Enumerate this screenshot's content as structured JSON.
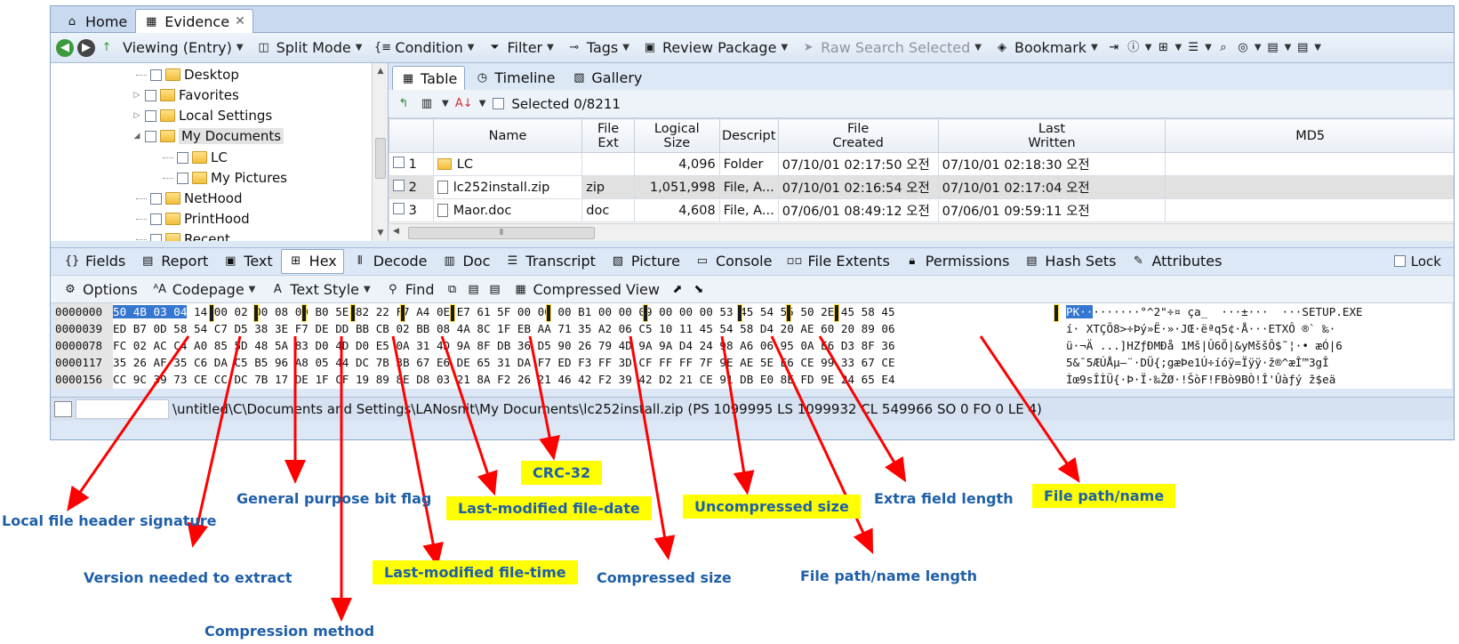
{
  "tabs": [
    {
      "label": "Home"
    },
    {
      "label": "Evidence"
    }
  ],
  "toolbar1": {
    "viewing": "Viewing (Entry)",
    "split": "Split Mode",
    "condition": "Condition",
    "filter": "Filter",
    "tags": "Tags",
    "review": "Review Package",
    "raw_search": "Raw Search Selected",
    "bookmark": "Bookmark"
  },
  "tree": {
    "items": [
      {
        "label": "Desktop"
      },
      {
        "label": "Favorites"
      },
      {
        "label": "Local Settings"
      },
      {
        "label": "My Documents"
      },
      {
        "label": "LC"
      },
      {
        "label": "My Pictures"
      },
      {
        "label": "NetHood"
      },
      {
        "label": "PrintHood"
      },
      {
        "label": "Recent"
      }
    ]
  },
  "view_tabs": [
    {
      "label": "Table"
    },
    {
      "label": "Timeline"
    },
    {
      "label": "Gallery"
    }
  ],
  "table_toolbar": {
    "selected": "Selected 0/8211"
  },
  "table": {
    "headers": {
      "name": "Name",
      "ext": "File\nExt",
      "size": "Logical\nSize",
      "desc": "Descript",
      "created": "File\nCreated",
      "written": "Last\nWritten",
      "md5": "MD5"
    },
    "rows": [
      {
        "idx": "1",
        "name": "LC",
        "ext": "",
        "size": "4,096",
        "desc": "Folder",
        "created": "07/10/01 02:17:50 오전",
        "written": "07/10/01 02:18:30 오전"
      },
      {
        "idx": "2",
        "name": "lc252install.zip",
        "ext": "zip",
        "size": "1,051,998",
        "desc": "File, A...",
        "created": "07/10/01 02:16:54 오전",
        "written": "07/10/01 02:17:04 오전"
      },
      {
        "idx": "3",
        "name": "Maor.doc",
        "ext": "doc",
        "size": "4,608",
        "desc": "File, A...",
        "created": "07/06/01 08:49:12 오전",
        "written": "07/06/01 09:59:11 오전"
      }
    ]
  },
  "bottom_tabs": [
    {
      "label": "Fields"
    },
    {
      "label": "Report"
    },
    {
      "label": "Text"
    },
    {
      "label": "Hex"
    },
    {
      "label": "Decode"
    },
    {
      "label": "Doc"
    },
    {
      "label": "Transcript"
    },
    {
      "label": "Picture"
    },
    {
      "label": "Console"
    },
    {
      "label": "File Extents"
    },
    {
      "label": "Permissions"
    },
    {
      "label": "Hash Sets"
    },
    {
      "label": "Attributes"
    }
  ],
  "lock": "Lock",
  "hex_toolbar": {
    "options": "Options",
    "codepage": "Codepage",
    "text_style": "Text Style",
    "find": "Find",
    "compressed": "Compressed View"
  },
  "hex": {
    "lines": [
      {
        "off": "0000000",
        "sel": "50 4B 03 04",
        "rest": " 14 00 02 00 08 00 B0 5E 82 22 F7 A4 0E E7 61 5F 00 00 00 B1 00 00 09 00 00 00 53 45 54 55 50 2E 45 58 45",
        "asc_sel": "PK··",
        "asc_rest": "·······°^2\"÷¤ ça_  ···±···  ···SETUP.EXE"
      },
      {
        "off": "0000039",
        "sel": "",
        "rest": "ED B7 0D 58 54 C7 D5 38 3E F7 DE DD BB CB 02 BB 08 4A 8C 1F EB AA 71 35 A2 06 C5 10 11 45 54 58 D4 20 AE 60 20 89 06",
        "asc_sel": "",
        "asc_rest": "í· XTÇÕ8>÷Þý»Ë·»·JŒ·ëªq5¢·Å···ETXÔ ®` ‰·"
      },
      {
        "off": "0000078",
        "sel": "",
        "rest": "FC 02 AC C4 A0 85 5D 48 5A 83 D0 4D D0 E5 0A 31 4D 9A 8F DB 36 D5 90 26 79 4D 9A 9A D4 24 98 A6 06 95 0A E6 D3 8F 36",
        "asc_sel": "",
        "asc_rest": "ü·¬Ä ...]HZƒÐMÐå 1Mš|Û6Õ|&yMššÔ$˜¦·• æÓ|6"
      },
      {
        "off": "0000117",
        "sel": "",
        "rest": "35 26 AF 35 C6 DA C5 B5 96 A8 05 44 DC 7B 3B 67 E6 DE 65 31 DA F7 ED F3 FF 3D CF FF FF 7F 9E AE 5E E6 CE 99 33 67 CE",
        "asc_sel": "",
        "asc_rest": "5&¯5ÆÚÅµ–¨·DÜ{;gæÞe1Ú÷íóÿ=Ïÿÿ·ž®^æÎ™3gÎ"
      },
      {
        "off": "0000156",
        "sel": "",
        "rest": "CC 9C 39 73 CE CC DC 7B 17 DE 1F CF 19 89 8E D8 03 21 8A F2 26 21 46 42 F2 39 42 D2 21 CE 91 DB E0 8E FD 9E 24 65 E4",
        "asc_sel": "",
        "asc_rest": "Ìœ9sÎÌÜ{·Þ·Ï·‰ŽØ·!ŠòF!FBò9BÒ!Î'Ûàƒý ž$eä"
      }
    ]
  },
  "status": {
    "path": "\\untitled\\C\\Documents and Settings\\LANosnit\\My Documents\\lc252install.zip (PS 1099995 LS 1099932 CL 549966 SO 0 FO 0 LE 4)"
  },
  "annotations": {
    "local_header": "Local file header signature",
    "gp_flag": "General purpose bit flag",
    "version": "Version needed to extract",
    "compression": "Compression method",
    "mod_time": "Last-modified file-time",
    "mod_date": "Last-modified file-date",
    "crc": "CRC-32",
    "comp_size": "Compressed size",
    "uncomp_size": "Uncompressed size",
    "name_len": "File path/name length",
    "extra_len": "Extra field length",
    "file_name": "File path/name"
  },
  "colors": {
    "accent": "#1f5fa8",
    "highlight": "#ffff00",
    "arrow": "#ff0000",
    "selection": "#3476d0"
  }
}
